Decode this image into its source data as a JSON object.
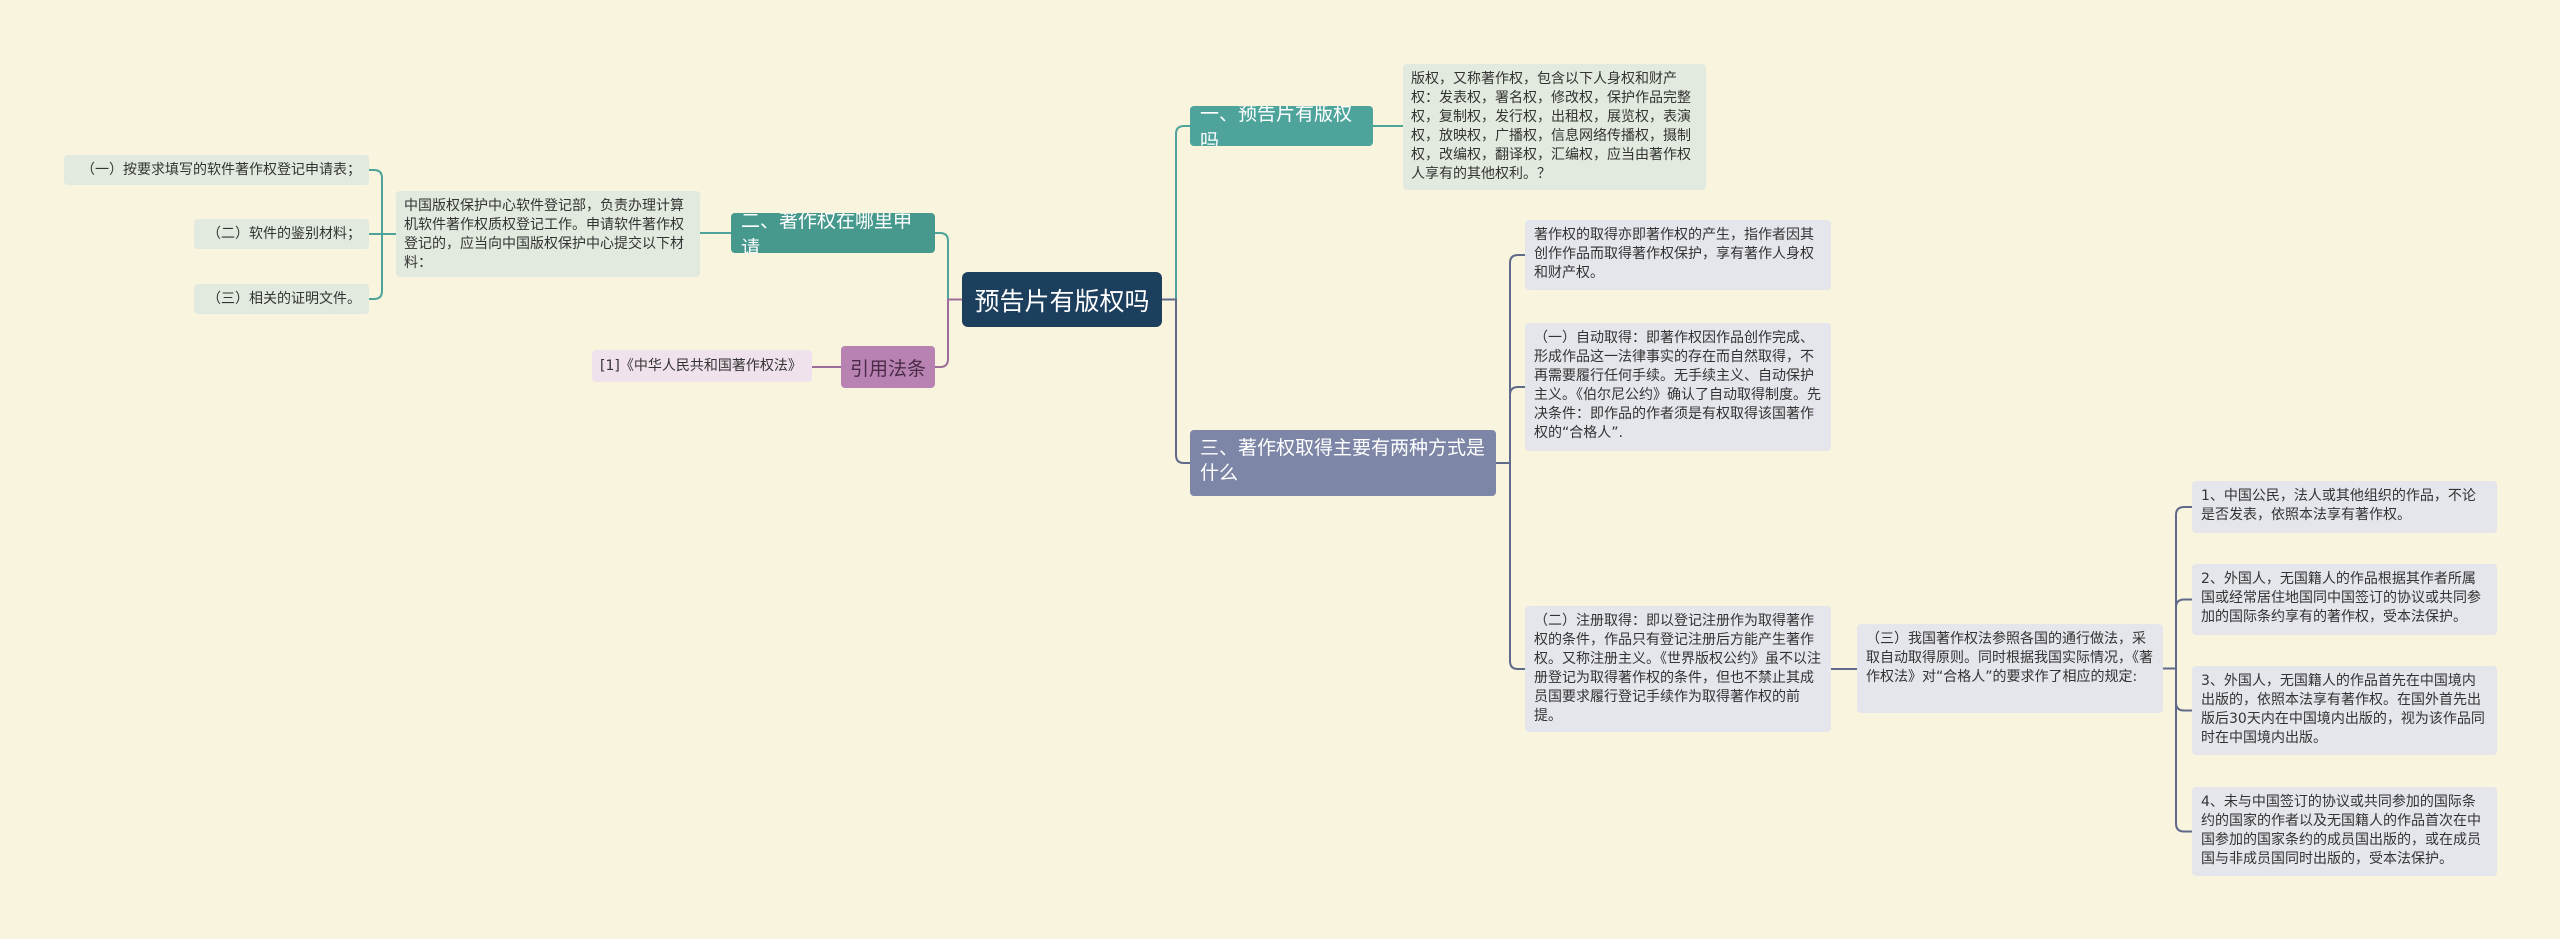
{
  "root": {
    "label": "预告片有版权吗"
  },
  "colors": {
    "background": "#f8f4dd",
    "root": "#1c3f5e",
    "branch1": "#4ea39b",
    "branch2": "#48998d",
    "branch3": "#7d86a6",
    "branch4": "#b882b2",
    "link_teal": "#4ea39b",
    "link_blue": "#5f6a8a",
    "link_purple": "#9e6e9a"
  },
  "branches": {
    "b1": {
      "label": "一、预告片有版权吗",
      "detail": "版权，又称著作权，包含以下人身权和财产权：发表权，署名权，修改权，保护作品完整权，复制权，发行权，出租权，展览权，表演权，放映权，广播权，信息网络传播权，摄制权，改编权，翻译权，汇编权，应当由著作权人享有的其他权利。？"
    },
    "b2": {
      "label": "二、著作权在哪里申请",
      "detail": "中国版权保护中心软件登记部，负责办理计算机软件著作权质权登记工作。申请软件著作权登记的，应当向中国版权保护中心提交以下材料：",
      "items": [
        "（一）按要求填写的软件著作权登记申请表；",
        "（二）软件的鉴别材料；",
        "（三）相关的证明文件。"
      ]
    },
    "b3": {
      "label": "三、著作权取得主要有两种方式是什么",
      "intro": "著作权的取得亦即著作权的产生，指作者因其创作作品而取得著作权保护，享有著作人身权和财产权。",
      "auto": "（一）自动取得：即著作权因作品创作完成、形成作品这一法律事实的存在而自然取得，不再需要履行任何手续。无手续主义、自动保护主义。《伯尔尼公约》确认了自动取得制度。先决条件：即作品的作者须是有权取得该国著作权的“合格人”.",
      "register": "（二）注册取得：即以登记注册作为取得著作权的条件，作品只有登记注册后方能产生著作权。又称注册主义。《世界版权公约》虽不以注册登记为取得著作权的条件，但也不禁止其成员国要求履行登记手续作为取得著作权的前提。",
      "third": "（三）我国著作权法参照各国的通行做法，采取自动取得原则。同时根据我国实际情况，《著作权法》对“合格人”的要求作了相应的规定:",
      "items": [
        "1、中国公民，法人或其他组织的作品，不论是否发表，依照本法享有著作权。",
        "2、外国人，无国籍人的作品根据其作者所属国或经常居住地国同中国签订的协议或共同参加的国际条约享有的著作权，受本法保护。",
        "3、外国人，无国籍人的作品首先在中国境内出版的，依照本法享有著作权。在国外首先出版后30天内在中国境内出版的，视为该作品同时在中国境内出版。",
        "4、未与中国签订的协议或共同参加的国际条约的国家的作者以及无国籍人的作品首次在中国参加的国家条约的成员国出版的，或在成员国与非成员国同时出版的，受本法保护。"
      ]
    },
    "b4": {
      "label": "引用法条",
      "items": [
        "[1]《中华人民共和国著作权法》"
      ]
    }
  }
}
